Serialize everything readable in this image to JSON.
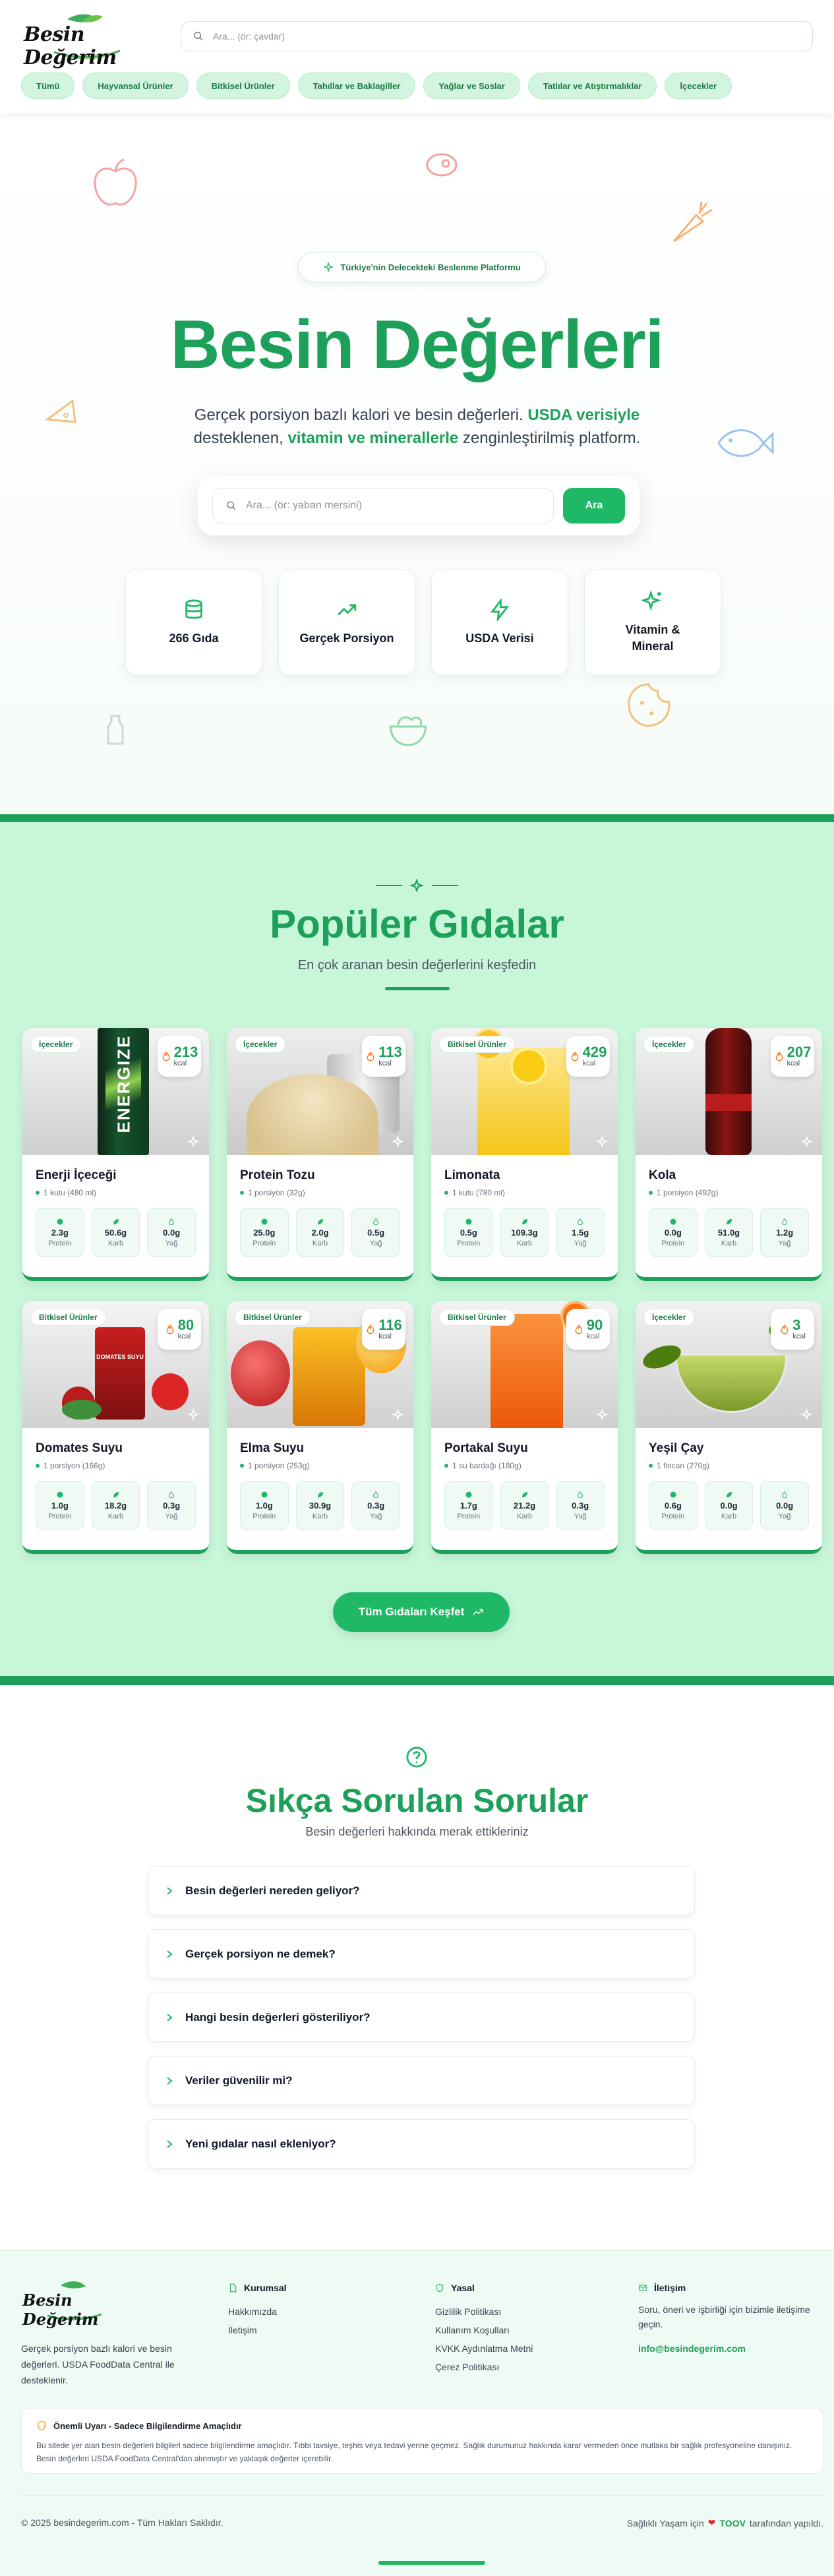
{
  "header": {
    "logo_text": "Besin Değerim",
    "search_placeholder": "Ara... (ör: çavdar)",
    "categories": [
      "Tümü",
      "Hayvansal Ürünler",
      "Bitkisel Ürünler",
      "Tahıllar ve Baklagiller",
      "Yağlar ve Soslar",
      "Tatlılar ve Atıştırmalıklar",
      "İçecekler"
    ]
  },
  "hero": {
    "badge": "Türkiye'nin Delecekteki Beslenme Platformu",
    "title": "Besin Değerleri",
    "sub_1": "Gerçek porsiyon bazlı kalori ve besin değerleri.",
    "sub_hl_1": "USDA verisiyle",
    "sub_2": "desteklenen,",
    "sub_hl_2": "vitamin ve minerallerle",
    "sub_3": "zenginleştirilmiş platform.",
    "search_placeholder": "Ara... (ör: yaban mersini)",
    "search_button": "Ara",
    "features": [
      "266 Gıda",
      "Gerçek Porsiyon",
      "USDA Verisi",
      "Vitamin & Mineral"
    ]
  },
  "popular": {
    "title": "Popüler Gıdalar",
    "subtitle": "En çok aranan besin değerlerini keşfedin",
    "kcal_unit": "kcal",
    "macro_labels": [
      "Protein",
      "Karb",
      "Yağ"
    ],
    "cards": [
      {
        "category": "İçecekler",
        "kcal": "213",
        "name": "Enerji İçeceği",
        "portion": "1 kutu (480 ml)",
        "protein": "2.3g",
        "carb": "50.6g",
        "fat": "0.0g",
        "image_label": "ENERGIZE"
      },
      {
        "category": "İçecekler",
        "kcal": "113",
        "name": "Protein Tozu",
        "portion": "1 porsiyon (32g)",
        "protein": "25.0g",
        "carb": "2.0g",
        "fat": "0.5g",
        "image_label": ""
      },
      {
        "category": "Bitkisel Ürünler",
        "kcal": "429",
        "name": "Limonata",
        "portion": "1 kutu (780 ml)",
        "protein": "0.5g",
        "carb": "109.3g",
        "fat": "1.5g",
        "image_label": ""
      },
      {
        "category": "İçecekler",
        "kcal": "207",
        "name": "Kola",
        "portion": "1 porsiyon (492g)",
        "protein": "0.0g",
        "carb": "51.0g",
        "fat": "1.2g",
        "image_label": ""
      },
      {
        "category": "Bitkisel Ürünler",
        "kcal": "80",
        "name": "Domates Suyu",
        "portion": "1 porsiyon (166g)",
        "protein": "1.0g",
        "carb": "18.2g",
        "fat": "0.3g",
        "image_label": "DOMATES SUYU"
      },
      {
        "category": "Bitkisel Ürünler",
        "kcal": "116",
        "name": "Elma Suyu",
        "portion": "1 porsiyon (253g)",
        "protein": "1.0g",
        "carb": "30.9g",
        "fat": "0.3g",
        "image_label": ""
      },
      {
        "category": "Bitkisel Ürünler",
        "kcal": "90",
        "name": "Portakal Suyu",
        "portion": "1 su bardağı (180g)",
        "protein": "1.7g",
        "carb": "21.2g",
        "fat": "0.3g",
        "image_label": ""
      },
      {
        "category": "İçecekler",
        "kcal": "3",
        "name": "Yeşil Çay",
        "portion": "1 fincan (270g)",
        "protein": "0.6g",
        "carb": "0.0g",
        "fat": "0.0g",
        "image_label": ""
      }
    ],
    "explore_button": "Tüm Gıdaları Keşfet"
  },
  "faq": {
    "title": "Sıkça Sorulan Sorular",
    "subtitle": "Besin değerleri hakkında merak ettikleriniz",
    "items": [
      "Besin değerleri nereden geliyor?",
      "Gerçek porsiyon ne demek?",
      "Hangi besin değerleri gösteriliyor?",
      "Veriler güvenilir mi?",
      "Yeni gıdalar nasıl ekleniyor?"
    ]
  },
  "footer": {
    "logo_text": "Besin Değerim",
    "description": "Gerçek porsiyon bazlı kalori ve besin değerleri. USDA FoodData Central ile desteklenir.",
    "kurumsal_title": "Kurumsal",
    "kurumsal_links": [
      "Hakkımızda",
      "İletişim"
    ],
    "yasal_title": "Yasal",
    "yasal_links": [
      "Gizlilik Politikası",
      "Kullanım Koşulları",
      "KVKK Aydınlatma Metni",
      "Çerez Politikası"
    ],
    "iletisim_title": "İletişim",
    "iletisim_text": "Soru, öneri ve işbirliği için bizimle iletişime geçin.",
    "email": "info@besindegerim.com",
    "warning_title": "Önemli Uyarı - Sadece Bilgilendirme Amaçlıdır",
    "warning_text": "Bu sitede yer alan besin değerleri bilgileri sadece bilgilendirme amaçlıdır. Tıbbi tavsiye, teşhis veya tedavi yerine geçmez. Sağlık durumunuz hakkında karar vermeden önce mutlaka bir sağlık profesyoneline danışınız. Besin değerleri USDA FoodData Central'dan alınmıştır ve yaklaşık değerler içerebilir.",
    "copyright": "© 2025 besindegerim.com - Tüm Hakları Saklıdır.",
    "made_prefix": "Sağlıklı Yaşam için",
    "made_brand": "TOOV",
    "made_suffix": "tarafından yapıldı."
  },
  "colors": {
    "accent": "#1da05a",
    "accent_light": "#c8f6d9",
    "button": "#1fb866"
  }
}
